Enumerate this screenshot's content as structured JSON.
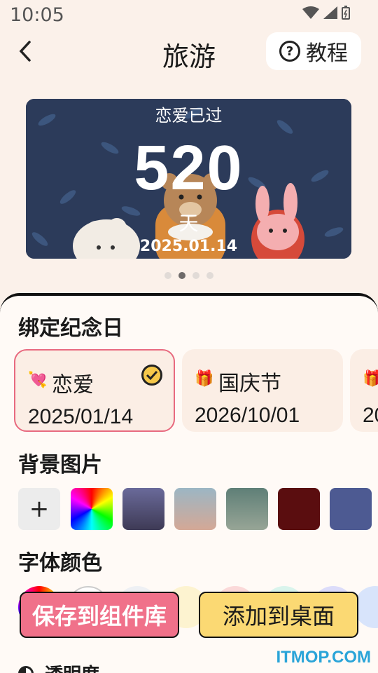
{
  "status_bar": {
    "time": "10:05"
  },
  "header": {
    "title": "旅游",
    "tutorial_label": "教程"
  },
  "preview": {
    "title": "恋爱已过",
    "count": "520",
    "unit": "天",
    "date": "2025.01.14"
  },
  "pager": {
    "count": 4,
    "active_index": 1
  },
  "bind_section": {
    "title": "绑定纪念日",
    "items": [
      {
        "icon": "💘",
        "name": "恋爱",
        "date": "2025/01/14",
        "selected": true
      },
      {
        "icon": "🎁",
        "name": "国庆节",
        "date": "2026/10/01",
        "selected": false
      },
      {
        "icon": "🎁",
        "name": "",
        "date": "20",
        "selected": false
      }
    ]
  },
  "background_section": {
    "title": "背景图片",
    "add_label": "+"
  },
  "color_section": {
    "title": "字体颜色"
  },
  "buttons": {
    "save": "保存到组件库",
    "add": "添加到桌面"
  },
  "transparency": {
    "label": "透明度"
  },
  "watermark": "ITMOP.COM"
}
